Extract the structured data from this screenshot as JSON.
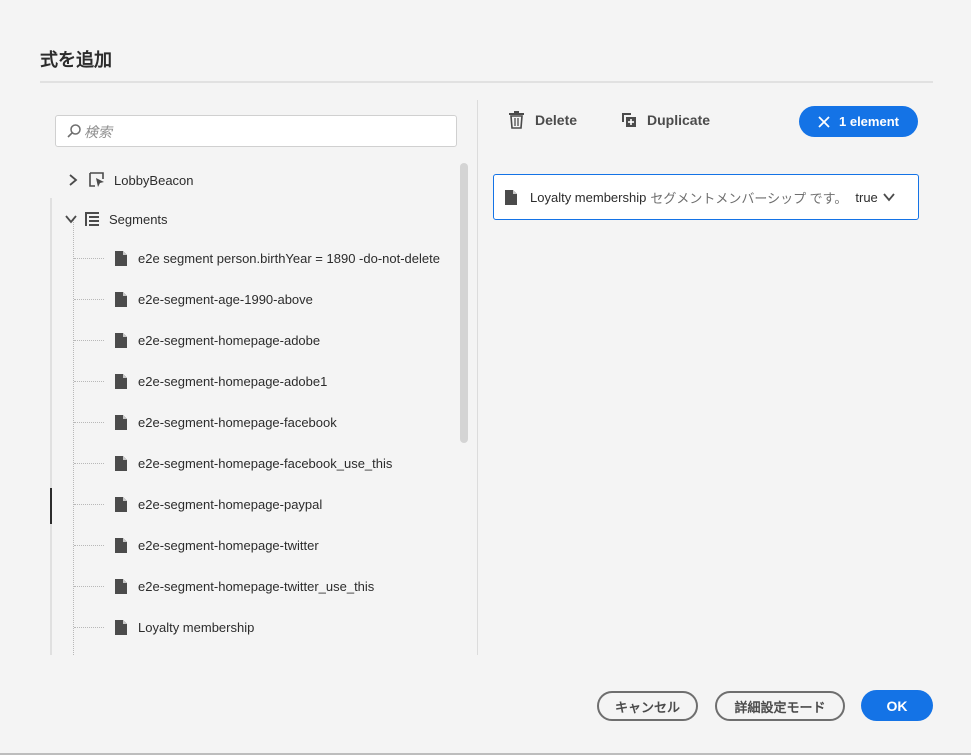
{
  "dialog": {
    "title": "式を追加"
  },
  "search": {
    "placeholder": "検索",
    "value": ""
  },
  "tree": {
    "parent_collapsed": "LobbyBeacon",
    "parent_expanded": "Segments",
    "leaves": [
      "e2e segment person.birthYear = 1890 -do-not-delete",
      "e2e-segment-age-1990-above",
      "e2e-segment-homepage-adobe",
      "e2e-segment-homepage-adobe1",
      "e2e-segment-homepage-facebook",
      "e2e-segment-homepage-facebook_use_this",
      "e2e-segment-homepage-paypal",
      "e2e-segment-homepage-twitter",
      "e2e-segment-homepage-twitter_use_this",
      "Loyalty membership"
    ]
  },
  "toolbar": {
    "delete_label": "Delete",
    "duplicate_label": "Duplicate",
    "selection_label": "1 element"
  },
  "expression": {
    "field": "Loyalty membership",
    "rule": "セグメントメンバーシップ です。",
    "value": "true"
  },
  "footer": {
    "cancel_label": "キャンセル",
    "advanced_label": "詳細設定モード",
    "ok_label": "OK"
  },
  "colors": {
    "accent": "#1473e6",
    "text": "#2c2c2c",
    "background": "#f4f4f4"
  },
  "icons": [
    "search-icon",
    "chevron-right-icon",
    "chevron-down-icon",
    "event-icon",
    "list-icon",
    "document-icon",
    "trash-icon",
    "duplicate-icon",
    "close-icon"
  ]
}
